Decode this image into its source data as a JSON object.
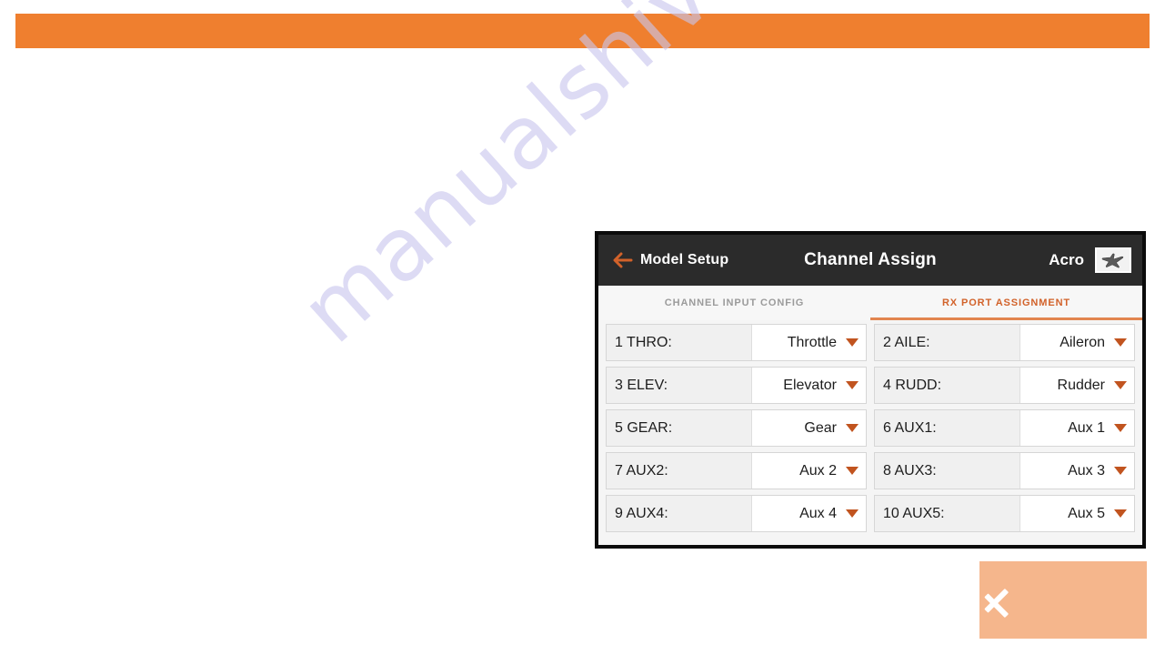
{
  "page": {
    "watermark_text": "manualshive.com",
    "banner_color": "#ef7f2f",
    "accent_color": "#d2622a"
  },
  "device": {
    "header": {
      "back_label": "Model Setup",
      "back_icon": "arrow-left-icon",
      "title": "Channel Assign",
      "model_name": "Acro",
      "model_icon": "airplane-icon"
    },
    "tabs": [
      {
        "label": "CHANNEL INPUT CONFIG",
        "active": false
      },
      {
        "label": "RX PORT ASSIGNMENT",
        "active": true
      }
    ],
    "rows": [
      [
        {
          "label": "1 THRO:",
          "value": "Throttle"
        },
        {
          "label": "2 AILE:",
          "value": "Aileron"
        }
      ],
      [
        {
          "label": "3 ELEV:",
          "value": "Elevator"
        },
        {
          "label": "4 RUDD:",
          "value": "Rudder"
        }
      ],
      [
        {
          "label": "5 GEAR:",
          "value": "Gear"
        },
        {
          "label": "6 AUX1:",
          "value": "Aux 1"
        }
      ],
      [
        {
          "label": "7 AUX2:",
          "value": "Aux 2"
        },
        {
          "label": "8 AUX3:",
          "value": "Aux 3"
        }
      ],
      [
        {
          "label": "9 AUX4:",
          "value": "Aux 4"
        },
        {
          "label": "10 AUX5:",
          "value": "Aux 5"
        }
      ]
    ]
  },
  "nav": {
    "prev_icon": "chevron-left-icon"
  }
}
